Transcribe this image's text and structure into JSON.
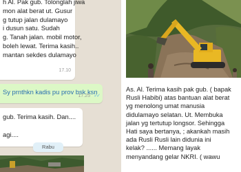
{
  "chat": {
    "messages": [
      {
        "type": "incoming",
        "lines": [
          "h Al. Pak gub. Tolonglah jiwa",
          "mon alat berat ut. Gusur",
          "g tutup jalan dulamayo",
          "i dusun satu. Sudah",
          "g. Tanah jalan. mobil motor,",
          " boleh lewat. Terima kasih..",
          "mantan sekdes dulamayo"
        ],
        "time": "17.10"
      },
      {
        "type": "outgoing",
        "lines": [
          "Sy prnthkn kadis pu prov bsk ksn"
        ],
        "time": "17.25"
      },
      {
        "type": "incoming",
        "lines": [
          "gub. Terima kasih. Dan....",
          "",
          "agi...."
        ],
        "time": ""
      }
    ],
    "date_divider": "Rabu"
  },
  "post": {
    "caption_lines": [
      "As. Al. Terima kasih pak gub. ( bapak",
      "Rusli Habibi) atas bantuan alat berat",
      "yg menolong umat manusia",
      "didulamayo selatan. Ut. Membuka",
      "jalan yg tertutup longsor. Sehingga",
      "Hati saya bertanya, ; akankah masih",
      "ada Rusli Rusli lain didunia ini",
      "kelak? ...... Memang layak",
      "menyandang gelar NKRI. ( wawu"
    ]
  },
  "colors": {
    "chat_background": "#e6dfd4",
    "incoming_bubble": "#ffffff",
    "outgoing_bubble": "#dcf8c6",
    "outgoing_text": "#2a6fb0",
    "read_ticks": "#5fb3e0",
    "excavator_yellow": "#e9b824"
  }
}
